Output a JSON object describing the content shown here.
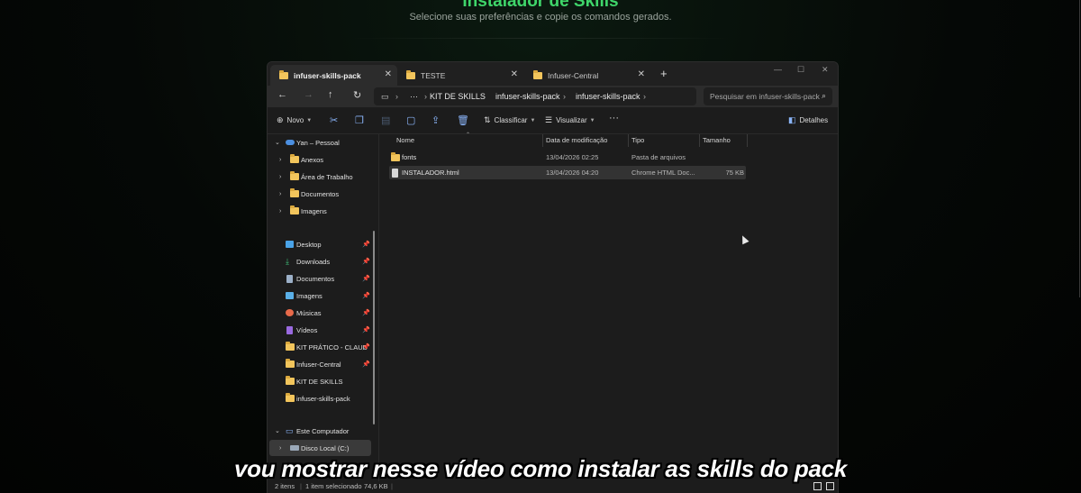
{
  "page": {
    "title": "Instalador de Skills",
    "subtitle": "Selecione suas preferências e copie os comandos gerados."
  },
  "tabs": [
    {
      "label": "infuser-skills-pack",
      "active": true
    },
    {
      "label": "TESTE",
      "active": false
    },
    {
      "label": "Infuser-Central",
      "active": false
    }
  ],
  "breadcrumb": [
    "KIT DE SKILLS",
    "infuser-skills-pack",
    "infuser-skills-pack"
  ],
  "search": {
    "placeholder": "Pesquisar em infuser-skills-pack"
  },
  "toolbar": {
    "new_label": "Novo",
    "sort_label": "Classificar",
    "view_label": "Visualizar",
    "details_label": "Detalhes"
  },
  "sidebar": {
    "account": "Yan – Pessoal",
    "account_folders": [
      "Anexos",
      "Área de Trabalho",
      "Documentos",
      "Imagens"
    ],
    "quick_access": [
      {
        "label": "Desktop",
        "icon": "desktop-icon"
      },
      {
        "label": "Downloads",
        "icon": "download-icon"
      },
      {
        "label": "Documentos",
        "icon": "document-icon"
      },
      {
        "label": "Imagens",
        "icon": "image-icon"
      },
      {
        "label": "Músicas",
        "icon": "music-icon"
      },
      {
        "label": "Vídeos",
        "icon": "video-icon"
      },
      {
        "label": "KIT PRÁTICO - CLAUD",
        "icon": "folder-icon"
      },
      {
        "label": "Infuser-Central",
        "icon": "folder-icon"
      },
      {
        "label": "KIT DE SKILLS",
        "icon": "folder-icon"
      },
      {
        "label": "infuser-skills-pack",
        "icon": "folder-icon"
      }
    ],
    "this_pc": "Este Computador",
    "drive": "Disco Local (C:)"
  },
  "columns": [
    "Nome",
    "Data de modificação",
    "Tipo",
    "Tamanho"
  ],
  "files": [
    {
      "name": "fonts",
      "modified": "13/04/2026 02:25",
      "type": "Pasta de arquivos",
      "size": "",
      "icon": "folder-icon"
    },
    {
      "name": "INSTALADOR.html",
      "modified": "13/04/2026 04:20",
      "type": "Chrome HTML Doc...",
      "size": "75 KB",
      "icon": "html-file-icon"
    }
  ],
  "status": {
    "items": "2 itens",
    "selected": "1 item selecionado",
    "size": "74,6 KB"
  },
  "caption": "vou mostrar nesse vídeo como instalar as skills do pack",
  "colors": {
    "accent": "#3fd66a",
    "folder": "#f2c55c",
    "window_bg": "#1c1c1c"
  }
}
